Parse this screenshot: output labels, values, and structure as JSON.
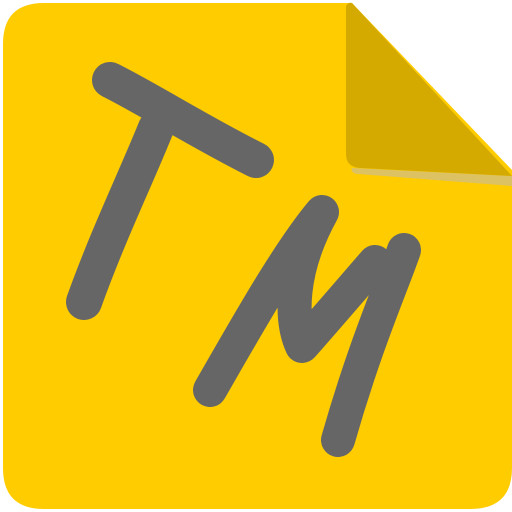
{
  "icon": {
    "name": "TM",
    "colors": {
      "body": "#ffcc00",
      "fold": "#d4aa00",
      "fold_shadow": "#dcc263",
      "glyph": "#666666"
    }
  }
}
